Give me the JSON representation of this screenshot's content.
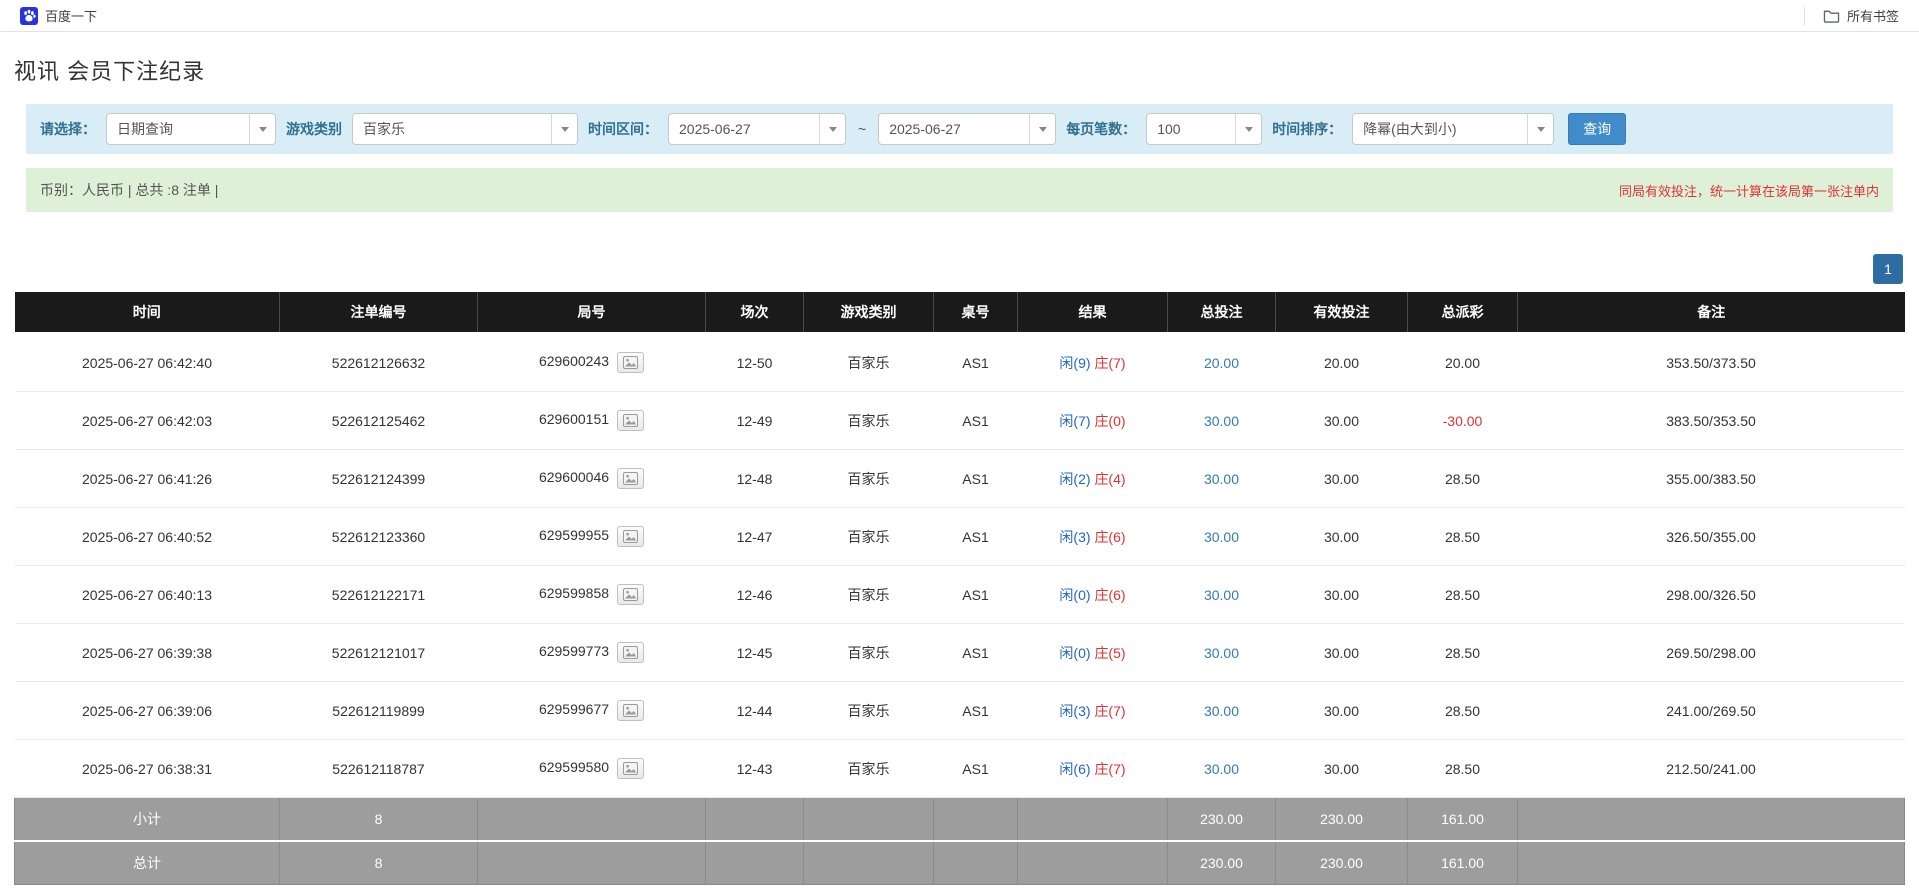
{
  "bookmarks_bar": {
    "baidu_label": "百度一下",
    "all_bookmarks_label": "所有书签"
  },
  "page": {
    "title": "视讯 会员下注纪录"
  },
  "filters": {
    "select_label": "请选择：",
    "select_value": "日期查询",
    "game_type_label": "游戏类别",
    "game_type_value": "百家乐",
    "date_range_label": "时间区间：",
    "date_from": "2025-06-27",
    "date_separator": "~",
    "date_to": "2025-06-27",
    "page_size_label": "每页笔数：",
    "page_size_value": "100",
    "sort_label": "时间排序：",
    "sort_value": "降幂(由大到小)",
    "search_button_label": "查询"
  },
  "summary_bar": {
    "left_text": "币别：人民币 | 总共 :8 注单 |",
    "right_notice": "同局有效投注，统一计算在该局第一张注单内"
  },
  "pagination": {
    "current_page": "1"
  },
  "icons": {
    "baidu_logo": "paw-on-blue-square",
    "all_bookmarks": "folder-outline",
    "round_replay": "film-frame-glyph",
    "select_caret": "▼"
  },
  "colors": {
    "filter_bg": "#d9edf7",
    "filter_label": "#31708f",
    "info_bg": "#dff0d8",
    "notice_red": "#e03131",
    "button_blue": "#428bca",
    "pagination_blue": "#2e6da4",
    "table_header_bg": "#1a1a1a",
    "footer_bg": "#9d9d9d",
    "link_blue": "#337ab7",
    "player_blue": "#2166c9",
    "banker_red": "#e03131"
  },
  "table": {
    "headers": [
      "时间",
      "注单编号",
      "局号",
      "场次",
      "游戏类别",
      "桌号",
      "结果",
      "总投注",
      "有效投注",
      "总派彩",
      "备注"
    ],
    "rows": [
      {
        "time": "2025-06-27 06:42:40",
        "bet_id": "522612126632",
        "round_id": "629600243",
        "session": "12-50",
        "game": "百家乐",
        "table_no": "AS1",
        "result_player": "闲(9)",
        "result_banker": "庄(7)",
        "total_bet": "20.00",
        "valid_bet": "20.00",
        "payout": "20.00",
        "note": "353.50/373.50"
      },
      {
        "time": "2025-06-27 06:42:03",
        "bet_id": "522612125462",
        "round_id": "629600151",
        "session": "12-49",
        "game": "百家乐",
        "table_no": "AS1",
        "result_player": "闲(7)",
        "result_banker": "庄(0)",
        "total_bet": "30.00",
        "valid_bet": "30.00",
        "payout": "-30.00",
        "note": "383.50/353.50"
      },
      {
        "time": "2025-06-27 06:41:26",
        "bet_id": "522612124399",
        "round_id": "629600046",
        "session": "12-48",
        "game": "百家乐",
        "table_no": "AS1",
        "result_player": "闲(2)",
        "result_banker": "庄(4)",
        "total_bet": "30.00",
        "valid_bet": "30.00",
        "payout": "28.50",
        "note": "355.00/383.50"
      },
      {
        "time": "2025-06-27 06:40:52",
        "bet_id": "522612123360",
        "round_id": "629599955",
        "session": "12-47",
        "game": "百家乐",
        "table_no": "AS1",
        "result_player": "闲(3)",
        "result_banker": "庄(6)",
        "total_bet": "30.00",
        "valid_bet": "30.00",
        "payout": "28.50",
        "note": "326.50/355.00"
      },
      {
        "time": "2025-06-27 06:40:13",
        "bet_id": "522612122171",
        "round_id": "629599858",
        "session": "12-46",
        "game": "百家乐",
        "table_no": "AS1",
        "result_player": "闲(0)",
        "result_banker": "庄(6)",
        "total_bet": "30.00",
        "valid_bet": "30.00",
        "payout": "28.50",
        "note": "298.00/326.50"
      },
      {
        "time": "2025-06-27 06:39:38",
        "bet_id": "522612121017",
        "round_id": "629599773",
        "session": "12-45",
        "game": "百家乐",
        "table_no": "AS1",
        "result_player": "闲(0)",
        "result_banker": "庄(5)",
        "total_bet": "30.00",
        "valid_bet": "30.00",
        "payout": "28.50",
        "note": "269.50/298.00"
      },
      {
        "time": "2025-06-27 06:39:06",
        "bet_id": "522612119899",
        "round_id": "629599677",
        "session": "12-44",
        "game": "百家乐",
        "table_no": "AS1",
        "result_player": "闲(3)",
        "result_banker": "庄(7)",
        "total_bet": "30.00",
        "valid_bet": "30.00",
        "payout": "28.50",
        "note": "241.00/269.50"
      },
      {
        "time": "2025-06-27 06:38:31",
        "bet_id": "522612118787",
        "round_id": "629599580",
        "session": "12-43",
        "game": "百家乐",
        "table_no": "AS1",
        "result_player": "闲(6)",
        "result_banker": "庄(7)",
        "total_bet": "30.00",
        "valid_bet": "30.00",
        "payout": "28.50",
        "note": "212.50/241.00"
      }
    ],
    "subtotal": {
      "label": "小计",
      "count": "8",
      "total_bet": "230.00",
      "valid_bet": "230.00",
      "payout": "161.00"
    },
    "total": {
      "label": "总计",
      "count": "8",
      "total_bet": "230.00",
      "valid_bet": "230.00",
      "payout": "161.00"
    }
  }
}
